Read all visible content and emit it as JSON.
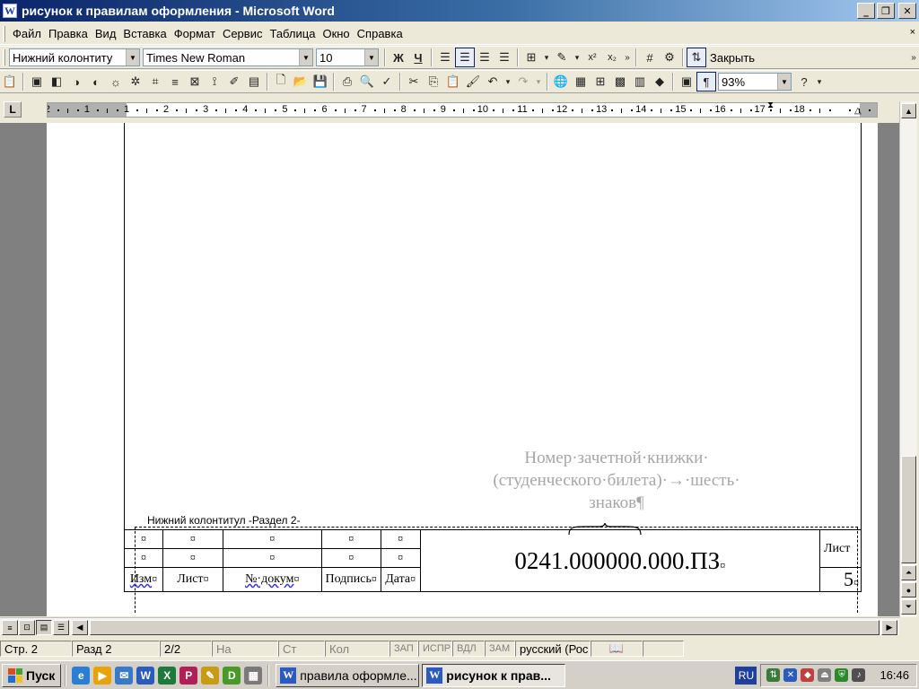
{
  "window": {
    "title": "рисунок к правилам оформления - Microsoft Word",
    "app_icon_letter": "W",
    "minimize": "_",
    "restore": "❐",
    "close": "✕"
  },
  "menu": {
    "items": [
      "Файл",
      "Правка",
      "Вид",
      "Вставка",
      "Формат",
      "Сервис",
      "Таблица",
      "Окно",
      "Справка"
    ],
    "overflow": "×"
  },
  "formatting": {
    "style": "Нижний колонтиту",
    "font": "Times New Roman",
    "size": "10",
    "bold": "Ж",
    "underline": "Ч",
    "close_label": "Закрыть"
  },
  "standard": {
    "zoom": "93%"
  },
  "ruler": {
    "corner": "L",
    "numbers": [
      "2",
      "1",
      "1",
      "2",
      "3",
      "4",
      "5",
      "6",
      "7",
      "8",
      "9",
      "10",
      "11",
      "12",
      "13",
      "14",
      "15",
      "16",
      "17",
      "18"
    ]
  },
  "document": {
    "annotation_lines": [
      "Номер·зачетной·книжки·",
      "(студенческого·билета)·→·шесть·",
      "знаков¶"
    ],
    "footer_tag": "Нижний колонтитул -Раздел 2-",
    "stamp": {
      "mark": "¤",
      "headers": [
        "Изм",
        "Лист",
        "№·докум",
        "Подпись",
        "Дата"
      ],
      "code": "0241.000000.000.ПЗ",
      "sheet_label": "Лист",
      "sheet_number": "5"
    }
  },
  "status": {
    "page": "Стр. 2",
    "section": "Разд 2",
    "pages": "2/2",
    "at": "На",
    "line": "Ст",
    "col": "Кол",
    "rec": "ЗАП",
    "trk": "ИСПР",
    "ext": "ВДЛ",
    "ovr": "ЗАМ",
    "language": "русский (Рос"
  },
  "taskbar": {
    "start": "Пуск",
    "tasks": [
      "правила оформле...",
      "рисунок к прав..."
    ],
    "language": "RU",
    "clock": "16:46"
  }
}
